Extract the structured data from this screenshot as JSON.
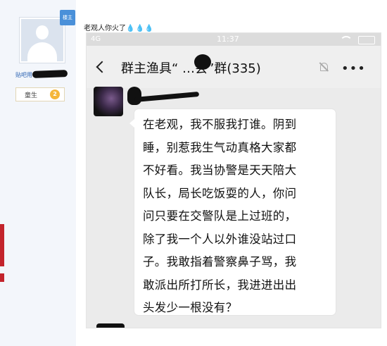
{
  "forum_user": {
    "owner_badge": "楼主",
    "username_prefix": "贴吧用",
    "level_label": "童生",
    "level_number": "2"
  },
  "post": {
    "title": "老观人你火了",
    "title_drops": "💧💧💧"
  },
  "phone": {
    "status_network": "4G",
    "status_time": "11:37",
    "group_title": "群主渔具“    …会”群(335)",
    "message": {
      "lines": [
        "在老观，我不服我打谁。阴到",
        "睡，别惹我生气动真格大家都",
        "不好看。我当协警是天天陪大",
        "队长，局长吃饭耍的人，你问",
        "问只要在交警队是上过班的，",
        "除了我一个人以外谁没站过口",
        "子。我敢指着警察鼻子骂，我",
        "敢派出所打所长，我进进出出",
        "头发少一根没有？"
      ]
    }
  },
  "icons": {
    "back": "back-arrow-icon",
    "mute": "mute-bell-icon",
    "more": "more-dots-icon",
    "wifi": "wifi-icon",
    "battery": "battery-icon"
  },
  "colors": {
    "page_bg": "#f4f6f9",
    "owner_badge": "#4a90d9",
    "username_link": "#2d64b3",
    "level_star": "#f5b63a",
    "chat_bg": "#ebebeb",
    "bubble_bg": "#ffffff"
  }
}
